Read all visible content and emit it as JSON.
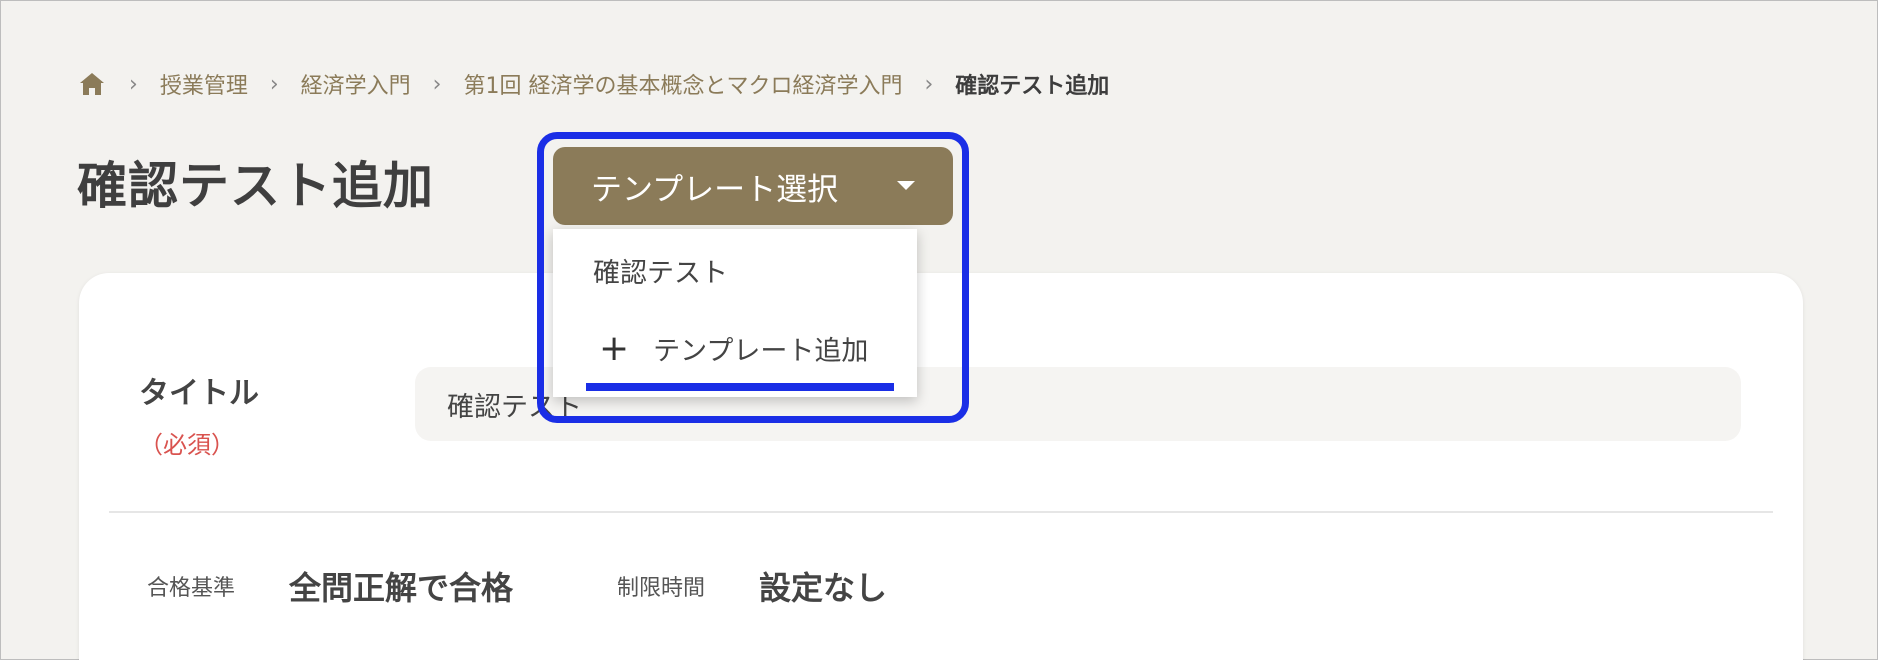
{
  "breadcrumb": {
    "items": [
      "授業管理",
      "経済学入門",
      "第1回 経済学の基本概念とマクロ経済学入門"
    ],
    "current": "確認テスト追加",
    "separator": "›"
  },
  "page": {
    "title": "確認テスト追加"
  },
  "template_select": {
    "label": "テンプレート選択",
    "options": [
      "確認テスト"
    ],
    "add_label": "テンプレート追加",
    "add_icon": "+"
  },
  "form": {
    "title_label": "タイトル",
    "required_note": "（必須）",
    "title_value": "確認テスト"
  },
  "meta": {
    "pass_label": "合格基準",
    "pass_value": "全問正解で合格",
    "time_label": "制限時間",
    "time_value": "設定なし"
  },
  "colors": {
    "accent": "#8b7b59",
    "highlight": "#1a2ee6",
    "required": "#d9534f",
    "background": "#f3f2ef"
  }
}
